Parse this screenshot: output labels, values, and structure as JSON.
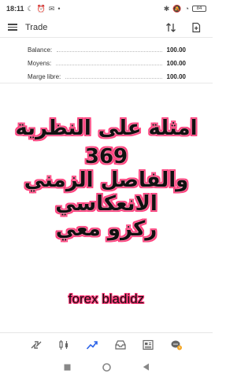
{
  "status_bar": {
    "time": "18:11",
    "battery": "84",
    "left_icons": [
      "moon-icon",
      "alarm-icon",
      "message-icon",
      "dots-icon"
    ],
    "right_icons": [
      "nfc-icon",
      "mute-icon",
      "alarm-icon",
      "wifi-icon",
      "battery-icon"
    ]
  },
  "app_bar": {
    "title": "Trade"
  },
  "account": {
    "rows": [
      {
        "label": "Balance:",
        "value": "100.00"
      },
      {
        "label": "Moyens:",
        "value": "100.00"
      },
      {
        "label": "Marge libre:",
        "value": "100.00"
      }
    ]
  },
  "overlay": {
    "line1": "امثلة على النظرية",
    "line2": "369",
    "line3": "والفاصل الزمني",
    "line4": "الانعكاسي",
    "line5": "ركزو معي",
    "watermark": "forex bladidz"
  },
  "bottom_nav": {
    "items": [
      "quotes-icon",
      "chart-icon",
      "trade-icon",
      "history-icon",
      "news-icon",
      "chat-icon"
    ],
    "active": "trade-icon",
    "accent_color": "#2a62e8",
    "badge_color": "#f5a623"
  },
  "colors": {
    "overlay_outline": "#ff3b7a",
    "overlay_text": "#111111"
  }
}
